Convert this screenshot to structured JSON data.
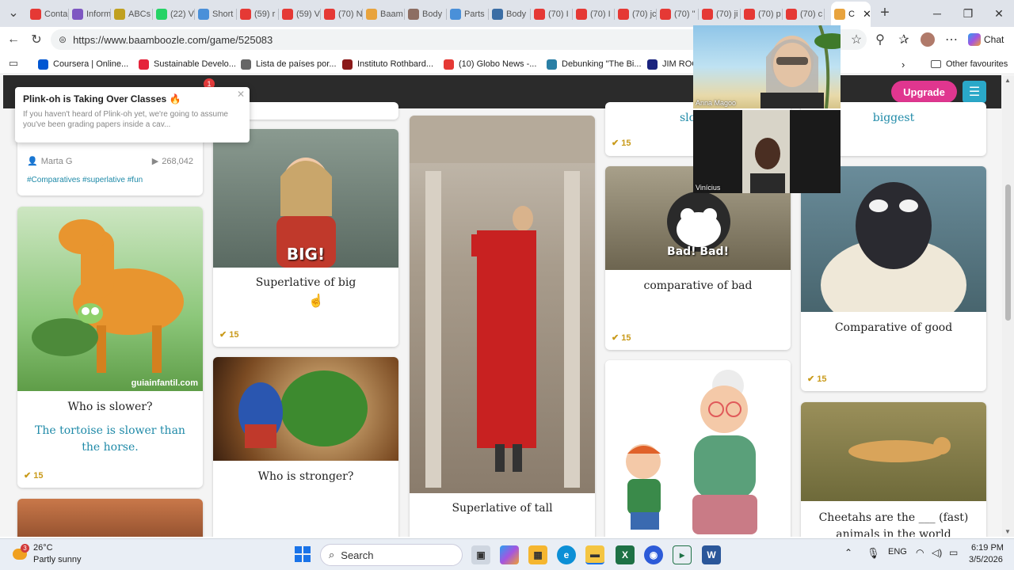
{
  "browser": {
    "tabs": [
      {
        "label": "Conta",
        "color": "#e53935"
      },
      {
        "label": "Inform",
        "color": "#7e57c2"
      },
      {
        "label": "ABCs",
        "color": "#c0a020"
      },
      {
        "label": "(22) V",
        "color": "#25d366"
      },
      {
        "label": "Short",
        "color": "#4a90d9"
      },
      {
        "label": "(59) r",
        "color": "#e53935"
      },
      {
        "label": "(59) V",
        "color": "#e53935"
      },
      {
        "label": "(70) N",
        "color": "#e53935"
      },
      {
        "label": "Baam",
        "color": "#e8a33d"
      },
      {
        "label": "Body",
        "color": "#8d6e63"
      },
      {
        "label": "Parts",
        "color": "#4a90d9"
      },
      {
        "label": "Body",
        "color": "#3b6ea5"
      },
      {
        "label": "(70) I",
        "color": "#e53935"
      },
      {
        "label": "(70) I",
        "color": "#e53935"
      },
      {
        "label": "(70) jc",
        "color": "#e53935"
      },
      {
        "label": "(70) \"",
        "color": "#e53935"
      },
      {
        "label": "(70) ji",
        "color": "#e53935"
      },
      {
        "label": "(70) p",
        "color": "#e53935"
      },
      {
        "label": "(70) c",
        "color": "#e53935"
      }
    ],
    "active_tab": {
      "label": "C",
      "color": "#e8a33d"
    },
    "url": "https://www.baamboozle.com/game/525083",
    "chat_label": "Chat",
    "bookmarks": [
      {
        "label": "Coursera | Online...",
        "color": "#0056d2"
      },
      {
        "label": "Sustainable Develo...",
        "color": "#e5243b"
      },
      {
        "label": "Lista de países por...",
        "color": "#666666"
      },
      {
        "label": "Instituto Rothbard...",
        "color": "#8b1a1a"
      },
      {
        "label": "(10) Globo News -...",
        "color": "#e53935"
      },
      {
        "label": "Debunking \"The Bi...",
        "color": "#2a7fa5"
      },
      {
        "label": "JIM ROGE",
        "color": "#1a237e"
      }
    ],
    "other_favourites": "Other favourites"
  },
  "site": {
    "notif_count": "1",
    "upgrade_label": "Upgrade",
    "popup": {
      "title": "Plink-oh is Taking Over Classes 🔥",
      "body": "If you haven't heard of Plink-oh yet, we're going to assume you've been grading papers inside a cav..."
    }
  },
  "cards": {
    "top_author": "Marta G",
    "top_plays": "268,042",
    "top_tags": "#Comparatives #superlative #fun",
    "c1": {
      "title": "Who is slower?",
      "answer": "The tortoise is slower than the horse.",
      "points": "15",
      "credit": "guiainfantil.com"
    },
    "c2": {
      "title": "Superlative of big",
      "caption": "BIG!",
      "points": "15"
    },
    "c3": {
      "title": "Who is stronger?"
    },
    "c4": {
      "title": "Superlative of tall"
    },
    "c5": {
      "title_partial": "slo",
      "points": "15"
    },
    "c6": {
      "title": "comparative  of bad",
      "caption": "Bad! Bad!",
      "points": "15"
    },
    "c8": {
      "title_partial": "biggest"
    },
    "c9": {
      "title": "Comparative  of good",
      "points": "15"
    },
    "c10": {
      "title": "Cheetahs are the ___ (fast) animals in the world"
    }
  },
  "video": {
    "p1": "Anna Magoo",
    "p2": "Vinícius"
  },
  "taskbar": {
    "temp": "26°C",
    "weather": "Partly sunny",
    "weather_badge": "3",
    "search": "Search",
    "lang": "ENG",
    "time": "6:19 PM",
    "date": "3/5/2026"
  }
}
